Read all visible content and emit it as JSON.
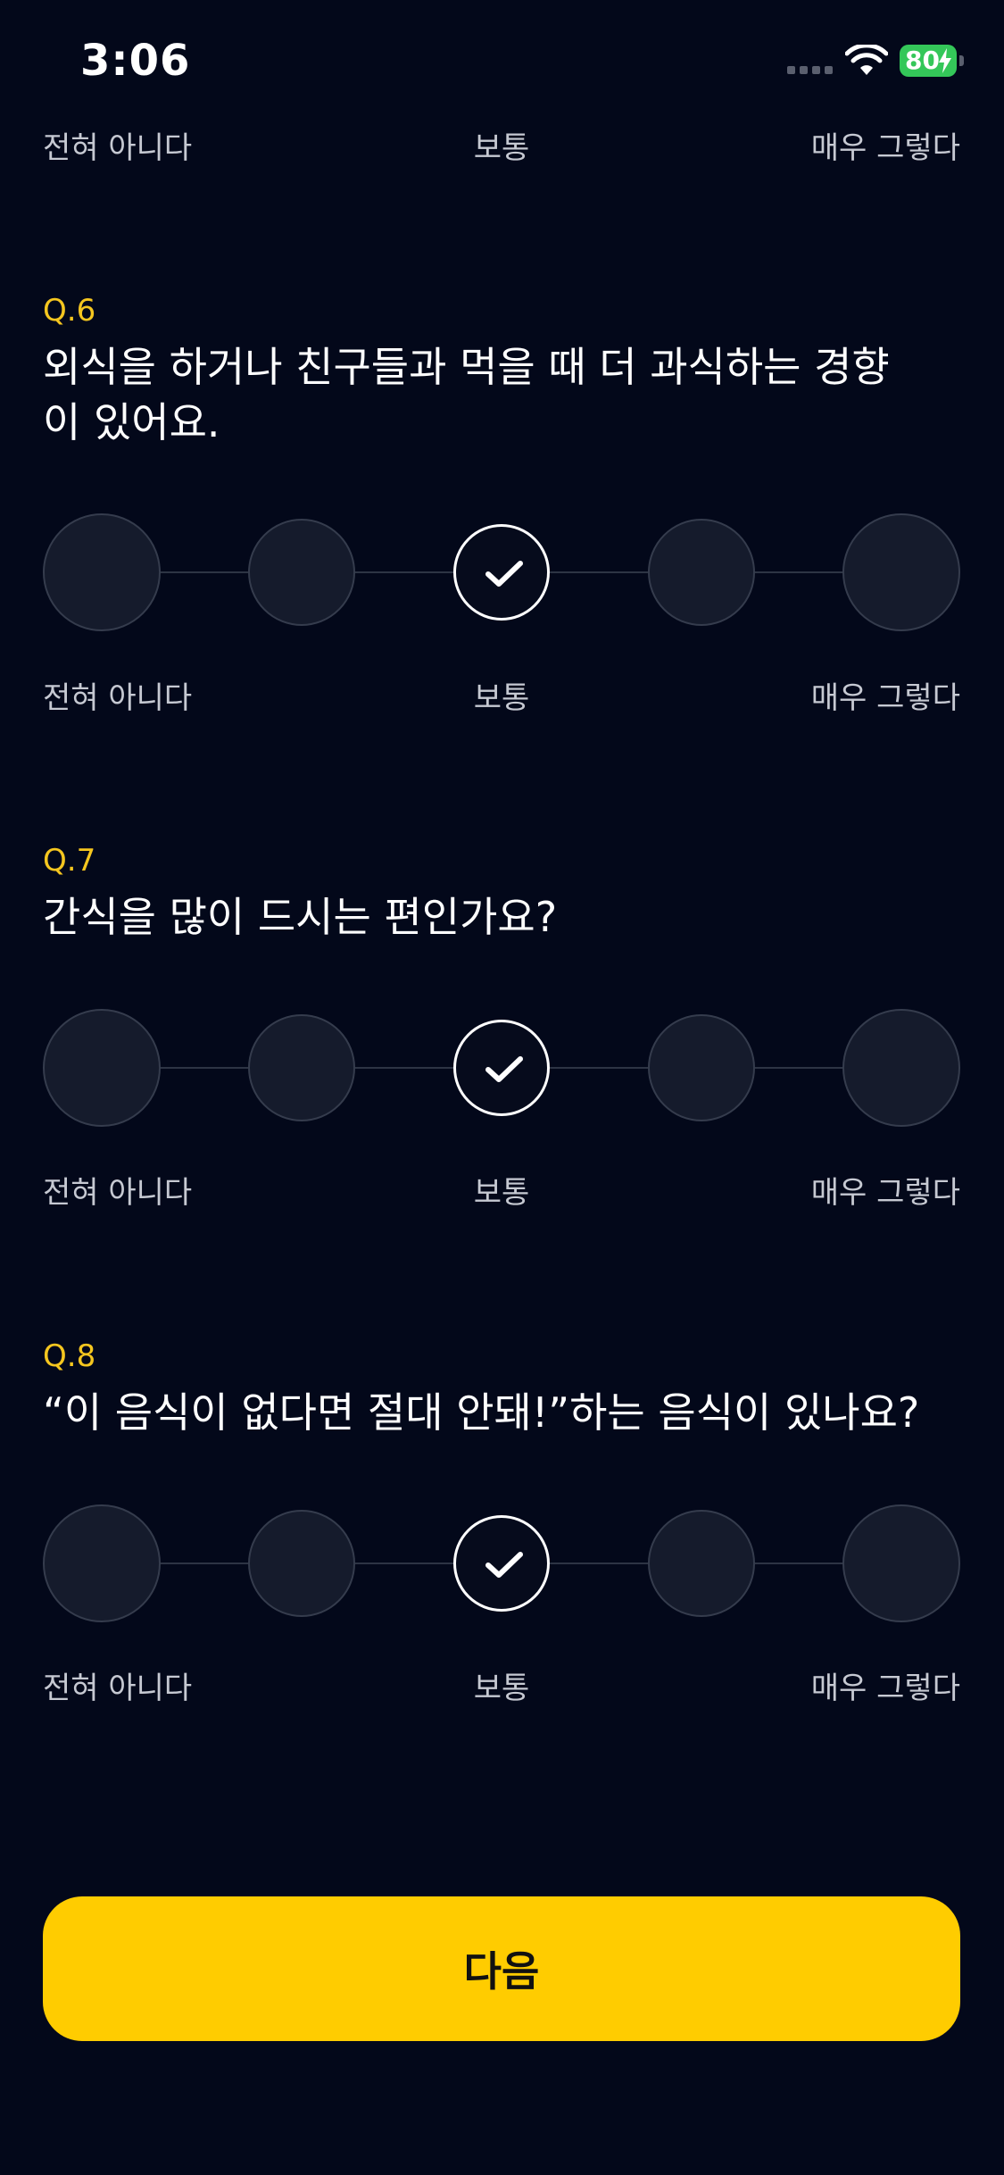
{
  "status_bar": {
    "time": "3:06",
    "battery": "80"
  },
  "scale": {
    "left": "전혀 아니다",
    "middle": "보통",
    "right": "매우 그렇다"
  },
  "questions": [
    {
      "number": "Q.6",
      "text": "외식을 하거나 친구들과 먹을 때 더 과식하는 경향이 있어요.",
      "selected": 3,
      "option_count": 5
    },
    {
      "number": "Q.7",
      "text": "간식을 많이 드시는 편인가요?",
      "selected": 3,
      "option_count": 5
    },
    {
      "number": "Q.8",
      "text": "“이 음식이 없다면 절대 안돼!”하는 음식이 있나요?",
      "selected": 3,
      "option_count": 5
    }
  ],
  "next_button": {
    "label": "다음"
  },
  "icons": {
    "wifi": "wifi-icon",
    "battery": "battery-icon",
    "check": "check-icon",
    "signal": "cellular-signal-icon"
  },
  "colors": {
    "background": "#03081a",
    "accent": "#ffcc00",
    "question_number": "#f5c61f",
    "battery": "#34c759"
  }
}
